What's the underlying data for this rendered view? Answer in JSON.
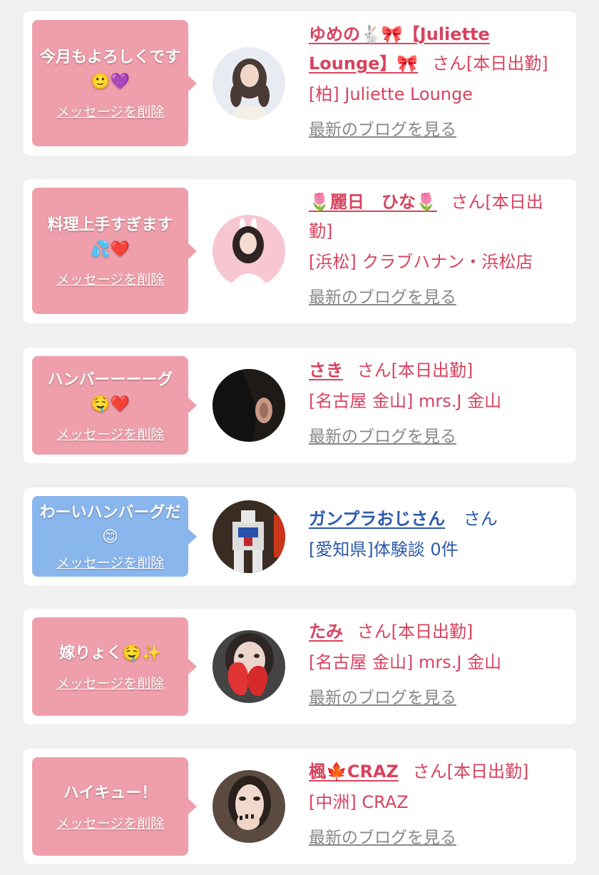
{
  "colors": {
    "pink_bubble": "#ee9fab",
    "blue_bubble": "#8ab6ee",
    "pink_text": "#d8435f",
    "blue_text": "#2e5aa8",
    "blog_link": "#888888"
  },
  "delete_label": "メッセージを削除",
  "items": [
    {
      "message": "今月もよろしくです🙂💜",
      "name": "ゆめの🐇🎀【Juliette Lounge】🎀",
      "honorific": "さん[本日出勤]",
      "shop": "[柏] Juliette Lounge",
      "blog": "最新のブログを見る"
    },
    {
      "message": "料理上手すぎます💦❤️",
      "name": "🌷麗日　ひな🌷",
      "honorific": "さん[本日出勤]",
      "shop": "[浜松] クラブハナン・浜松店",
      "blog": "最新のブログを見る"
    },
    {
      "message": "ハンバーーーーグ🤤❤️",
      "name": "さき",
      "honorific": "さん[本日出勤]",
      "shop": "[名古屋 金山] mrs.J 金山",
      "blog": "最新のブログを見る"
    },
    {
      "message": "わーいハンバーグだ😊",
      "name": "ガンプラおじさん",
      "honorific": "さん",
      "shop": "[愛知県]体験談 0件",
      "blog": ""
    },
    {
      "message": "嫁りょく🤤✨",
      "name": "たみ",
      "honorific": "さん[本日出勤]",
      "shop": "[名古屋 金山] mrs.J 金山",
      "blog": "最新のブログを見る"
    },
    {
      "message": "ハイキュー！",
      "name": "楓🍁CRAZ",
      "honorific": "さん[本日出勤]",
      "shop": "[中洲] CRAZ",
      "blog": "最新のブログを見る"
    }
  ]
}
